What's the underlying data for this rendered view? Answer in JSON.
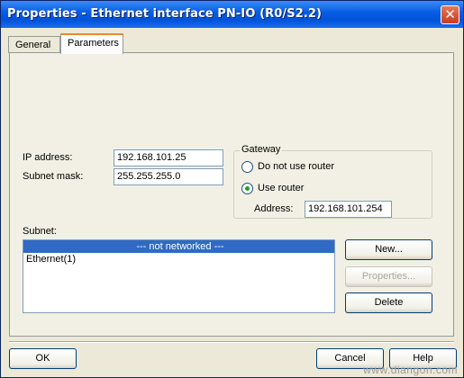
{
  "window": {
    "title": "Properties - Ethernet interface  PN-IO (R0/S2.2)",
    "close_glyph": "✕"
  },
  "tabs": [
    {
      "label": "General",
      "active": false
    },
    {
      "label": "Parameters",
      "active": true
    }
  ],
  "ip_address": {
    "label": "IP address:",
    "value": "192.168.101.25"
  },
  "subnet_mask": {
    "label": "Subnet mask:",
    "value": "255.255.255.0"
  },
  "gateway": {
    "title": "Gateway",
    "option_no_router": "Do not use router",
    "option_use_router": "Use router",
    "selected": "use_router",
    "address_label": "Address:",
    "address_value": "192.168.101.254"
  },
  "subnet": {
    "label": "Subnet:",
    "items": [
      "--- not networked ---",
      "Ethernet(1)"
    ],
    "selected_index": 0
  },
  "subnet_buttons": {
    "new": "New...",
    "properties": "Properties...",
    "delete": "Delete"
  },
  "footer": {
    "ok": "OK",
    "cancel": "Cancel",
    "help": "Help"
  },
  "watermark": "www.diangon.com",
  "colors": {
    "titlebar": "#0052d9",
    "selection": "#316ac5",
    "accent_tab": "#e68b2c"
  }
}
